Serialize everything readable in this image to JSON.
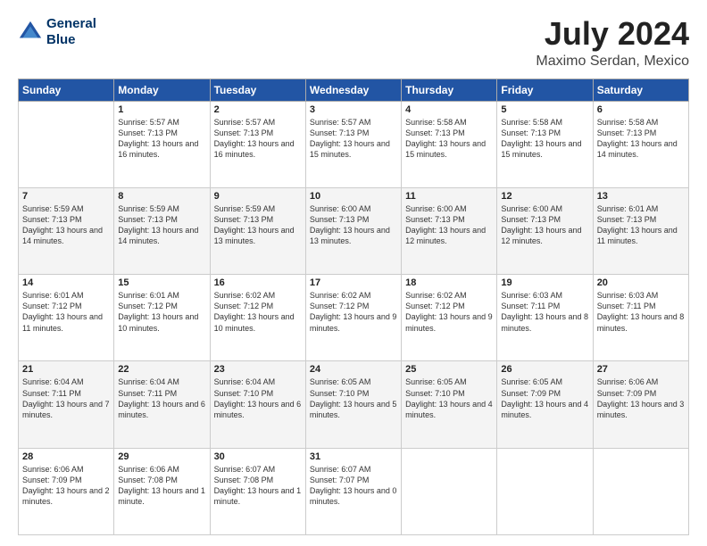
{
  "header": {
    "logo_line1": "General",
    "logo_line2": "Blue",
    "month": "July 2024",
    "location": "Maximo Serdan, Mexico"
  },
  "days_of_week": [
    "Sunday",
    "Monday",
    "Tuesday",
    "Wednesday",
    "Thursday",
    "Friday",
    "Saturday"
  ],
  "weeks": [
    [
      {
        "day": "",
        "sunrise": "",
        "sunset": "",
        "daylight": ""
      },
      {
        "day": "1",
        "sunrise": "Sunrise: 5:57 AM",
        "sunset": "Sunset: 7:13 PM",
        "daylight": "Daylight: 13 hours and 16 minutes."
      },
      {
        "day": "2",
        "sunrise": "Sunrise: 5:57 AM",
        "sunset": "Sunset: 7:13 PM",
        "daylight": "Daylight: 13 hours and 16 minutes."
      },
      {
        "day": "3",
        "sunrise": "Sunrise: 5:57 AM",
        "sunset": "Sunset: 7:13 PM",
        "daylight": "Daylight: 13 hours and 15 minutes."
      },
      {
        "day": "4",
        "sunrise": "Sunrise: 5:58 AM",
        "sunset": "Sunset: 7:13 PM",
        "daylight": "Daylight: 13 hours and 15 minutes."
      },
      {
        "day": "5",
        "sunrise": "Sunrise: 5:58 AM",
        "sunset": "Sunset: 7:13 PM",
        "daylight": "Daylight: 13 hours and 15 minutes."
      },
      {
        "day": "6",
        "sunrise": "Sunrise: 5:58 AM",
        "sunset": "Sunset: 7:13 PM",
        "daylight": "Daylight: 13 hours and 14 minutes."
      }
    ],
    [
      {
        "day": "7",
        "sunrise": "Sunrise: 5:59 AM",
        "sunset": "Sunset: 7:13 PM",
        "daylight": "Daylight: 13 hours and 14 minutes."
      },
      {
        "day": "8",
        "sunrise": "Sunrise: 5:59 AM",
        "sunset": "Sunset: 7:13 PM",
        "daylight": "Daylight: 13 hours and 14 minutes."
      },
      {
        "day": "9",
        "sunrise": "Sunrise: 5:59 AM",
        "sunset": "Sunset: 7:13 PM",
        "daylight": "Daylight: 13 hours and 13 minutes."
      },
      {
        "day": "10",
        "sunrise": "Sunrise: 6:00 AM",
        "sunset": "Sunset: 7:13 PM",
        "daylight": "Daylight: 13 hours and 13 minutes."
      },
      {
        "day": "11",
        "sunrise": "Sunrise: 6:00 AM",
        "sunset": "Sunset: 7:13 PM",
        "daylight": "Daylight: 13 hours and 12 minutes."
      },
      {
        "day": "12",
        "sunrise": "Sunrise: 6:00 AM",
        "sunset": "Sunset: 7:13 PM",
        "daylight": "Daylight: 13 hours and 12 minutes."
      },
      {
        "day": "13",
        "sunrise": "Sunrise: 6:01 AM",
        "sunset": "Sunset: 7:13 PM",
        "daylight": "Daylight: 13 hours and 11 minutes."
      }
    ],
    [
      {
        "day": "14",
        "sunrise": "Sunrise: 6:01 AM",
        "sunset": "Sunset: 7:12 PM",
        "daylight": "Daylight: 13 hours and 11 minutes."
      },
      {
        "day": "15",
        "sunrise": "Sunrise: 6:01 AM",
        "sunset": "Sunset: 7:12 PM",
        "daylight": "Daylight: 13 hours and 10 minutes."
      },
      {
        "day": "16",
        "sunrise": "Sunrise: 6:02 AM",
        "sunset": "Sunset: 7:12 PM",
        "daylight": "Daylight: 13 hours and 10 minutes."
      },
      {
        "day": "17",
        "sunrise": "Sunrise: 6:02 AM",
        "sunset": "Sunset: 7:12 PM",
        "daylight": "Daylight: 13 hours and 9 minutes."
      },
      {
        "day": "18",
        "sunrise": "Sunrise: 6:02 AM",
        "sunset": "Sunset: 7:12 PM",
        "daylight": "Daylight: 13 hours and 9 minutes."
      },
      {
        "day": "19",
        "sunrise": "Sunrise: 6:03 AM",
        "sunset": "Sunset: 7:11 PM",
        "daylight": "Daylight: 13 hours and 8 minutes."
      },
      {
        "day": "20",
        "sunrise": "Sunrise: 6:03 AM",
        "sunset": "Sunset: 7:11 PM",
        "daylight": "Daylight: 13 hours and 8 minutes."
      }
    ],
    [
      {
        "day": "21",
        "sunrise": "Sunrise: 6:04 AM",
        "sunset": "Sunset: 7:11 PM",
        "daylight": "Daylight: 13 hours and 7 minutes."
      },
      {
        "day": "22",
        "sunrise": "Sunrise: 6:04 AM",
        "sunset": "Sunset: 7:11 PM",
        "daylight": "Daylight: 13 hours and 6 minutes."
      },
      {
        "day": "23",
        "sunrise": "Sunrise: 6:04 AM",
        "sunset": "Sunset: 7:10 PM",
        "daylight": "Daylight: 13 hours and 6 minutes."
      },
      {
        "day": "24",
        "sunrise": "Sunrise: 6:05 AM",
        "sunset": "Sunset: 7:10 PM",
        "daylight": "Daylight: 13 hours and 5 minutes."
      },
      {
        "day": "25",
        "sunrise": "Sunrise: 6:05 AM",
        "sunset": "Sunset: 7:10 PM",
        "daylight": "Daylight: 13 hours and 4 minutes."
      },
      {
        "day": "26",
        "sunrise": "Sunrise: 6:05 AM",
        "sunset": "Sunset: 7:09 PM",
        "daylight": "Daylight: 13 hours and 4 minutes."
      },
      {
        "day": "27",
        "sunrise": "Sunrise: 6:06 AM",
        "sunset": "Sunset: 7:09 PM",
        "daylight": "Daylight: 13 hours and 3 minutes."
      }
    ],
    [
      {
        "day": "28",
        "sunrise": "Sunrise: 6:06 AM",
        "sunset": "Sunset: 7:09 PM",
        "daylight": "Daylight: 13 hours and 2 minutes."
      },
      {
        "day": "29",
        "sunrise": "Sunrise: 6:06 AM",
        "sunset": "Sunset: 7:08 PM",
        "daylight": "Daylight: 13 hours and 1 minute."
      },
      {
        "day": "30",
        "sunrise": "Sunrise: 6:07 AM",
        "sunset": "Sunset: 7:08 PM",
        "daylight": "Daylight: 13 hours and 1 minute."
      },
      {
        "day": "31",
        "sunrise": "Sunrise: 6:07 AM",
        "sunset": "Sunset: 7:07 PM",
        "daylight": "Daylight: 13 hours and 0 minutes."
      },
      {
        "day": "",
        "sunrise": "",
        "sunset": "",
        "daylight": ""
      },
      {
        "day": "",
        "sunrise": "",
        "sunset": "",
        "daylight": ""
      },
      {
        "day": "",
        "sunrise": "",
        "sunset": "",
        "daylight": ""
      }
    ]
  ]
}
